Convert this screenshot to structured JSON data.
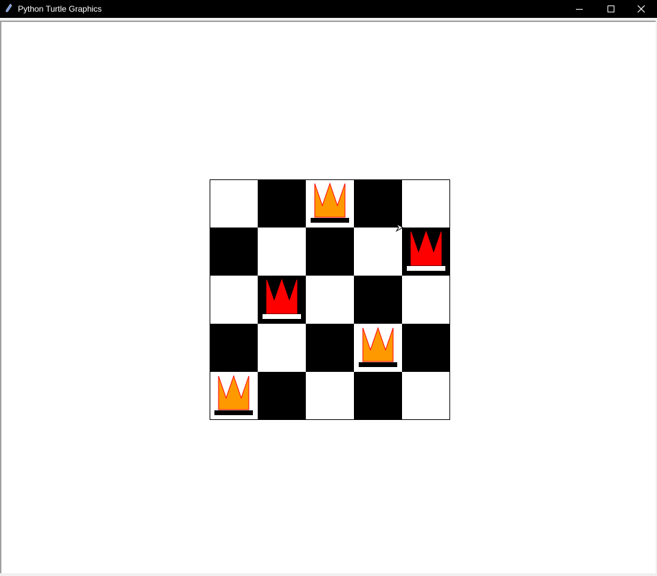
{
  "window": {
    "title": "Python Turtle Graphics",
    "titlebar_color": "#000000",
    "title_color": "#ffffff",
    "controls": [
      "minimize-icon",
      "maximize-icon",
      "close-icon"
    ]
  },
  "canvas": {
    "background": "#ffffff"
  },
  "board": {
    "size": 5,
    "dark_color": "#000000",
    "light_color": "#ffffff",
    "top_left_dark": false,
    "queens": [
      {
        "row": 0,
        "col": 2,
        "crown_color": "#ff9900",
        "base_color": "#000000"
      },
      {
        "row": 1,
        "col": 4,
        "crown_color": "#ff0000",
        "base_color": "#ffffff"
      },
      {
        "row": 2,
        "col": 1,
        "crown_color": "#ff0000",
        "base_color": "#ffffff"
      },
      {
        "row": 3,
        "col": 3,
        "crown_color": "#ff9900",
        "base_color": "#000000"
      },
      {
        "row": 4,
        "col": 0,
        "crown_color": "#ff9900",
        "base_color": "#000000"
      }
    ],
    "crown_outline": "#ff0000"
  },
  "turtle": {
    "shape": "arrow-cursor-icon",
    "heading": "right"
  }
}
